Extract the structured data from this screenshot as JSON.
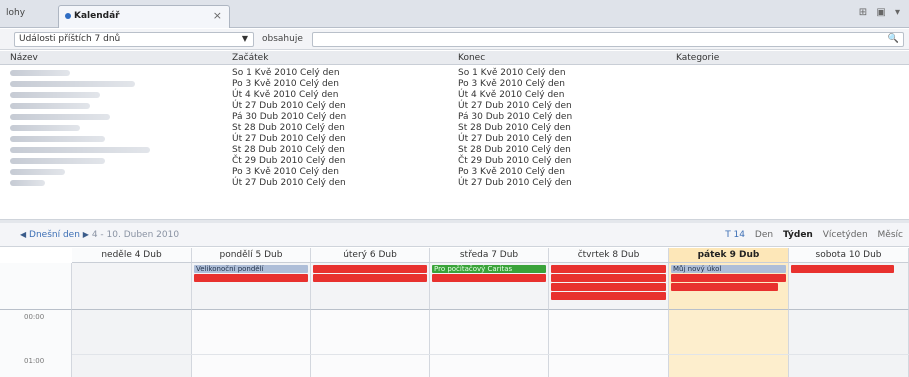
{
  "tabs": {
    "previous_label": "lohy",
    "active_label": "Kalendář",
    "close_icon": "×"
  },
  "filter": {
    "scope_value": "Události příštích 7 dnů",
    "contains_label": "obsahuje",
    "search_value": ""
  },
  "table": {
    "columns": [
      "Název",
      "Začátek",
      "Konec",
      "Kategorie"
    ],
    "rows": [
      {
        "start": "So 1 Kvě 2010 Celý den",
        "end": "So 1 Kvě 2010 Celý den"
      },
      {
        "start": "Po 3 Kvě 2010 Celý den",
        "end": "Po 3 Kvě 2010 Celý den"
      },
      {
        "start": "Út 4 Kvě 2010 Celý den",
        "end": "Út 4 Kvě 2010 Celý den"
      },
      {
        "start": "Út 27 Dub 2010 Celý den",
        "end": "Út 27 Dub 2010 Celý den"
      },
      {
        "start": "Pá 30 Dub 2010 Celý den",
        "end": "Pá 30 Dub 2010 Celý den"
      },
      {
        "start": "St 28 Dub 2010 Celý den",
        "end": "St 28 Dub 2010 Celý den"
      },
      {
        "start": "Út 27 Dub 2010 Celý den",
        "end": "Út 27 Dub 2010 Celý den"
      },
      {
        "start": "St 28 Dub 2010 Celý den",
        "end": "St 28 Dub 2010 Celý den"
      },
      {
        "start": "Čt 29 Dub 2010 Celý den",
        "end": "Čt 29 Dub 2010 Celý den"
      },
      {
        "start": "Po 3 Kvě 2010 Celý den",
        "end": "Po 3 Kvě 2010 Celý den"
      },
      {
        "start": "Út 27 Dub 2010 Celý den",
        "end": "Út 27 Dub 2010 Celý den"
      }
    ]
  },
  "calendar_toolbar": {
    "today_label": "Dnešní den",
    "range_label": "4 - 10. Duben 2010",
    "week_number": "T 14",
    "views": [
      "Den",
      "Týden",
      "Vícetýden",
      "Měsíc"
    ],
    "active_view": "Týden"
  },
  "calendar": {
    "days": [
      {
        "label": "neděle 4 Dub",
        "today": false
      },
      {
        "label": "pondělí 5 Dub",
        "today": false
      },
      {
        "label": "úterý 6 Dub",
        "today": false
      },
      {
        "label": "středa 7 Dub",
        "today": false
      },
      {
        "label": "čtvrtek 8 Dub",
        "today": false
      },
      {
        "label": "pátek 9 Dub",
        "today": true
      },
      {
        "label": "sobota 10 Dub",
        "today": false
      }
    ],
    "hours": [
      "00:00",
      "01:00"
    ],
    "events": {
      "mon_1": "Velikonoční pondělí",
      "wed_1": "Pro počítačový Caritas",
      "fri_1": "Můj nový úkol"
    }
  },
  "colors": {
    "event_red": "#e8312e",
    "event_green": "#3aa33a",
    "event_blue": "#aebed8",
    "today_bg": "#fde7b8"
  }
}
